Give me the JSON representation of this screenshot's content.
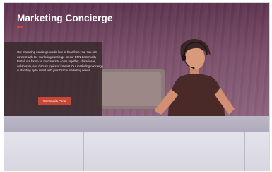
{
  "hero": {
    "title": "Marketing Concierge",
    "body": "Our marketing concierge would love to hear from you! You can connect with the marketing concierge on our OPN Community Portal, our forum for marketers to come together, share ideas, collaborate, and discuss topics of interest. Our marketing concierge is standing by to assist with your Oracle marketing needs.",
    "cta_label": "Community Portal"
  },
  "illustration": {
    "subject": "support agent wearing a headset at a desk",
    "icons": [
      "person-icon",
      "headset-icon",
      "chair-icon"
    ]
  },
  "colors": {
    "hero_background": "#6f4560",
    "accent": "#c74634",
    "panel": "#34282a",
    "desk": "#d8d6e0"
  }
}
